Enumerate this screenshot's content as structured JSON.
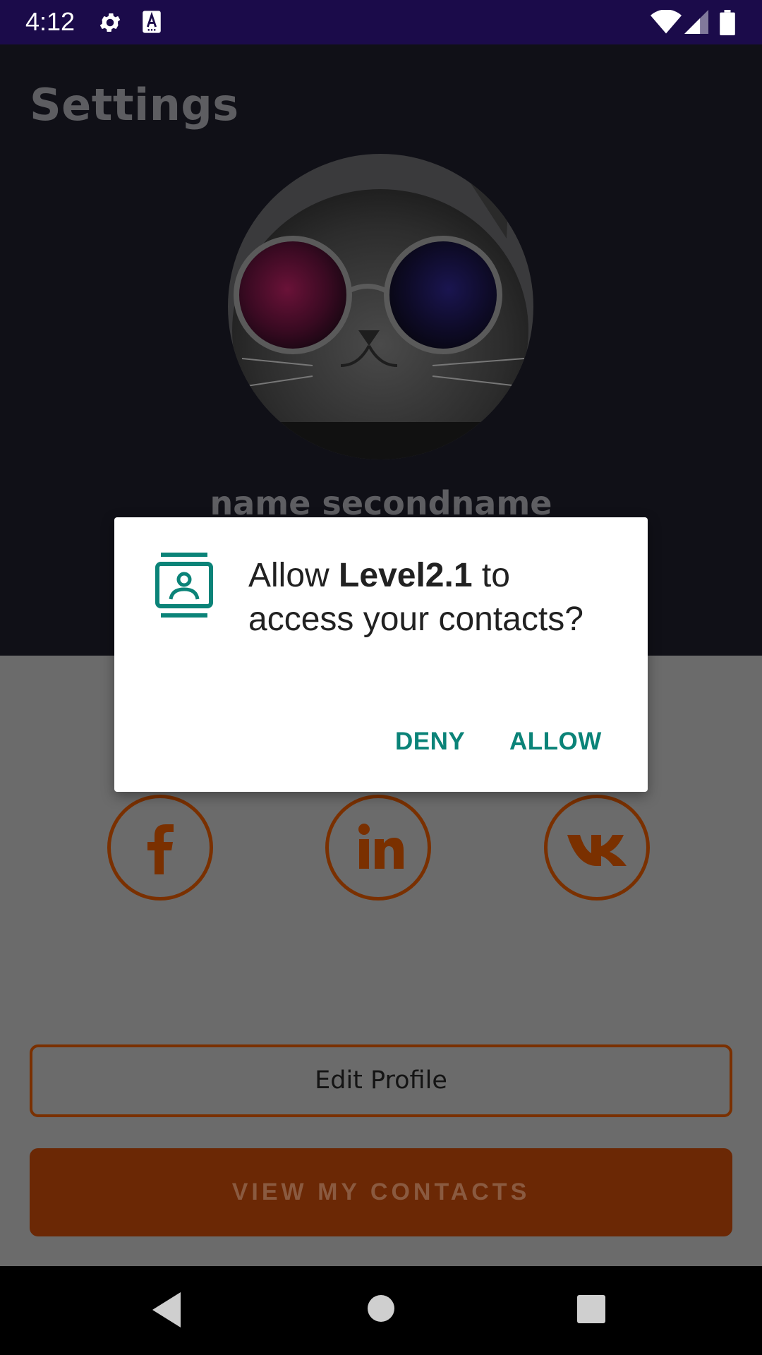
{
  "status_bar": {
    "time": "4:12",
    "icons": [
      "gear-icon",
      "text-a-icon",
      "wifi-icon",
      "cell-signal-icon",
      "battery-icon"
    ]
  },
  "page": {
    "title": "Settings",
    "profile_name": "name secondname",
    "avatar": "cat-with-sunglasses-avatar"
  },
  "social": {
    "items": [
      "facebook-icon",
      "linkedin-icon",
      "vk-icon"
    ]
  },
  "buttons": {
    "edit_profile": "Edit Profile",
    "view_contacts": "VIEW MY CONTACTS"
  },
  "dialog": {
    "message_prefix": "Allow ",
    "app_name": "Level2.1",
    "message_suffix": " to access your contacts?",
    "deny_label": "DENY",
    "allow_label": "ALLOW",
    "icon": "contacts-icon",
    "accent_color": "#0b8378"
  },
  "colors": {
    "status_bar": "#1b0b4a",
    "accent_orange": "#7a3000",
    "scrim_background": "#6b6b6b"
  }
}
